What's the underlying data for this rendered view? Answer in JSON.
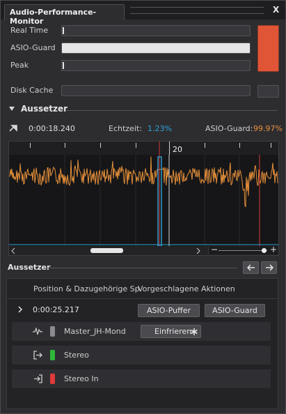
{
  "window": {
    "title": "Audio-Performance-Monitor",
    "close": "X"
  },
  "meters": {
    "realtime_label": "Real Time",
    "asioguard_label": "ASIO-Guard",
    "peak_label": "Peak",
    "diskcache_label": "Disk Cache",
    "realtime_level": 0.01,
    "asioguard_level": 1.0,
    "peak_level": 0.01
  },
  "colors": {
    "overload": "#e05536",
    "accent_blue": "#2fa3d8",
    "accent_orange": "#e8913a",
    "green": "#2db83a",
    "red": "#e03a3a"
  },
  "dropouts": {
    "section_title": "Aussetzer",
    "time": "0:00:18.240",
    "realtime_label": "Echtzeit:",
    "realtime_value": "1.23%",
    "asioguard_label": "ASIO-Guard:",
    "asioguard_value": "99.97%",
    "ruler_marker": "20"
  },
  "list": {
    "title": "Aussetzer",
    "col1": "Position & Dazugehörige Sp.",
    "col2": "Vorgeschlagene Aktionen",
    "entry_time": "0:00:25.217",
    "btn_buffer": "ASIO-Puffer",
    "btn_guard": "ASIO-Guard",
    "rows": [
      {
        "name": "Master_JH-Mond",
        "action": "Einfrieren"
      },
      {
        "name": "Stereo"
      },
      {
        "name": "Stereo In"
      }
    ]
  },
  "icons": [
    "chevron-down-icon",
    "chevron-right-icon",
    "waveform-icon",
    "output-icon",
    "input-icon",
    "arrow-left-icon",
    "arrow-right-icon",
    "asterisk-icon",
    "playhead-icon"
  ]
}
